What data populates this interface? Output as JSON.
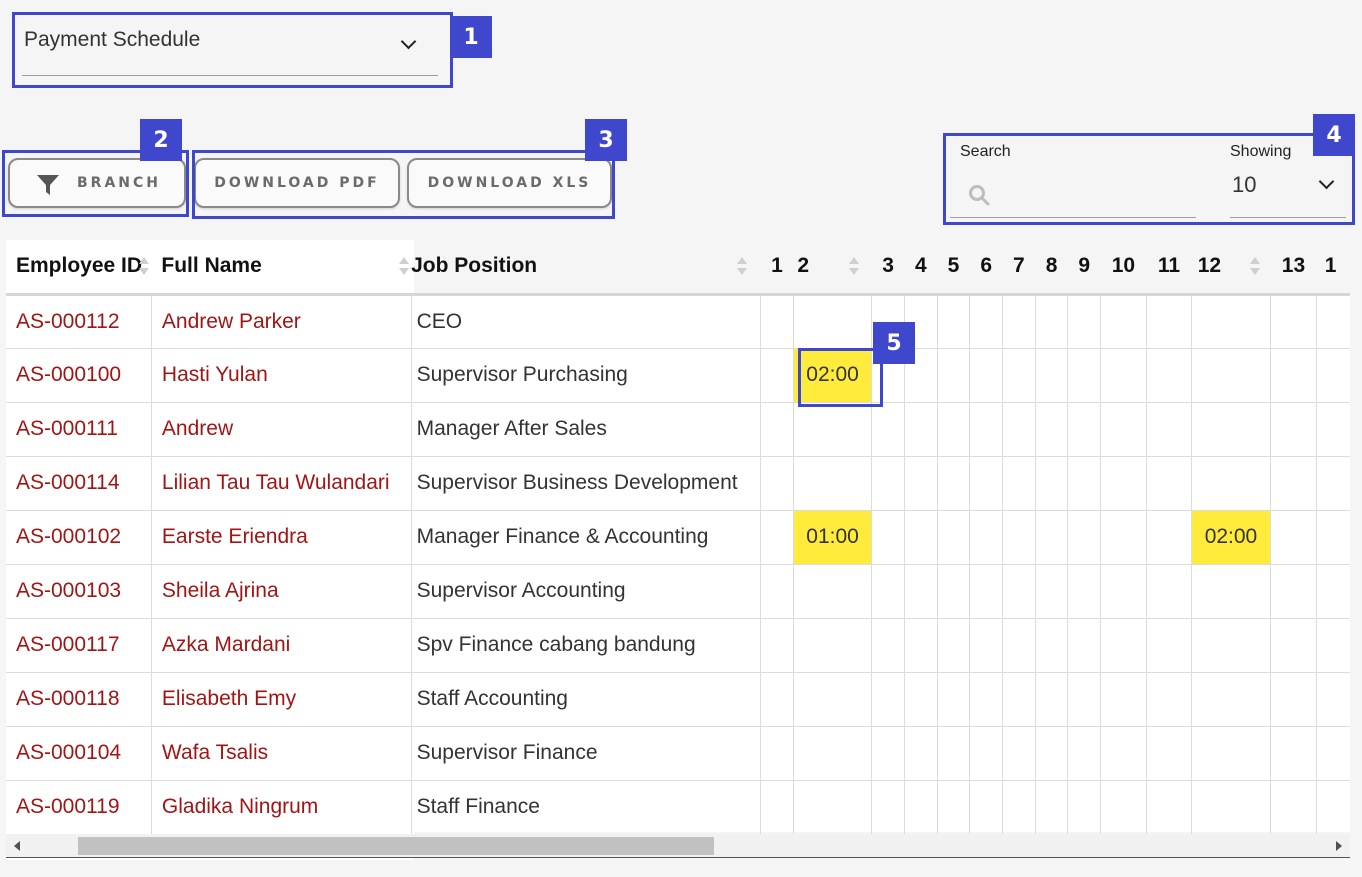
{
  "schedule_select": {
    "value": "Payment Schedule"
  },
  "buttons": {
    "branch": "BRANCH",
    "download_pdf": "DOWNLOAD PDF",
    "download_xls": "DOWNLOAD XLS"
  },
  "search": {
    "label": "Search",
    "placeholder": ""
  },
  "showing": {
    "label": "Showing",
    "value": "10"
  },
  "annotations": [
    "1",
    "2",
    "3",
    "4",
    "5"
  ],
  "table": {
    "headers": {
      "employee_id": "Employee ID",
      "full_name": "Full Name",
      "job_position": "Job Position",
      "days": [
        "1",
        "2",
        "3",
        "4",
        "5",
        "6",
        "7",
        "8",
        "9",
        "10",
        "11",
        "12",
        "13",
        "1"
      ]
    },
    "rows": [
      {
        "id": "AS-000112",
        "name": "Andrew Parker",
        "position": "CEO",
        "days": [
          "",
          "",
          "",
          "",
          "",
          "",
          "",
          "",
          "",
          "",
          "",
          "",
          "",
          ""
        ]
      },
      {
        "id": "AS-000100",
        "name": "Hasti Yulan",
        "position": "Supervisor Purchasing",
        "days": [
          "",
          "02:00",
          "",
          "",
          "",
          "",
          "",
          "",
          "",
          "",
          "",
          "",
          "",
          ""
        ]
      },
      {
        "id": "AS-000111",
        "name": "Andrew",
        "position": "Manager After Sales",
        "days": [
          "",
          "",
          "",
          "",
          "",
          "",
          "",
          "",
          "",
          "",
          "",
          "",
          "",
          ""
        ]
      },
      {
        "id": "AS-000114",
        "name": "Lilian Tau Tau Wulandari",
        "position": "Supervisor Business Development",
        "days": [
          "",
          "",
          "",
          "",
          "",
          "",
          "",
          "",
          "",
          "",
          "",
          "",
          "",
          ""
        ]
      },
      {
        "id": "AS-000102",
        "name": "Earste Eriendra",
        "position": "Manager Finance & Accounting",
        "days": [
          "",
          "01:00",
          "",
          "",
          "",
          "",
          "",
          "",
          "",
          "",
          "",
          "02:00",
          "",
          ""
        ]
      },
      {
        "id": "AS-000103",
        "name": "Sheila Ajrina",
        "position": "Supervisor Accounting",
        "days": [
          "",
          "",
          "",
          "",
          "",
          "",
          "",
          "",
          "",
          "",
          "",
          "",
          "",
          ""
        ]
      },
      {
        "id": "AS-000117",
        "name": "Azka Mardani",
        "position": "Spv Finance cabang bandung",
        "days": [
          "",
          "",
          "",
          "",
          "",
          "",
          "",
          "",
          "",
          "",
          "",
          "",
          "",
          ""
        ]
      },
      {
        "id": "AS-000118",
        "name": "Elisabeth Emy",
        "position": "Staff Accounting",
        "days": [
          "",
          "",
          "",
          "",
          "",
          "",
          "",
          "",
          "",
          "",
          "",
          "",
          "",
          ""
        ]
      },
      {
        "id": "AS-000104",
        "name": "Wafa Tsalis",
        "position": "Supervisor Finance",
        "days": [
          "",
          "",
          "",
          "",
          "",
          "",
          "",
          "",
          "",
          "",
          "",
          "",
          "",
          ""
        ]
      },
      {
        "id": "AS-000119",
        "name": "Gladika Ningrum",
        "position": "Staff Finance",
        "days": [
          "",
          "",
          "",
          "",
          "",
          "",
          "",
          "",
          "",
          "",
          "",
          "",
          "",
          ""
        ]
      }
    ]
  },
  "colors": {
    "link": "#a31515",
    "highlight": "#ffeb3b",
    "annotation": "#3f48cc"
  }
}
